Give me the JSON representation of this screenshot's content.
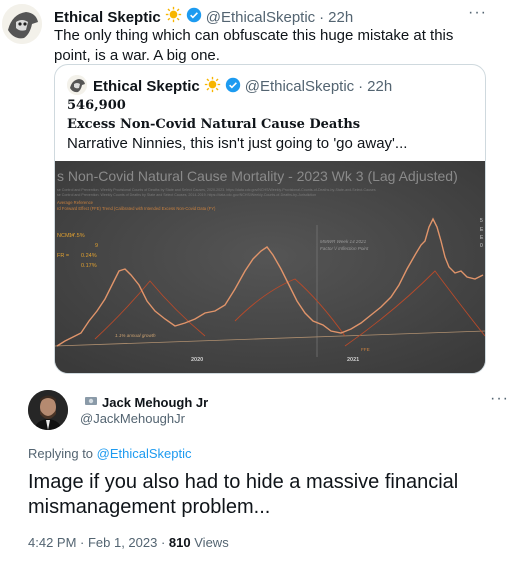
{
  "top_tweet": {
    "display_name": "Ethical Skeptic",
    "handle": "@EthicalSkeptic",
    "separator": "·",
    "time": "22h",
    "more": "···",
    "text": "The only thing which can obfuscate this huge mistake at this point, is a war. A big one."
  },
  "quote_tweet": {
    "display_name": "Ethical Skeptic",
    "handle": "@EthicalSkeptic",
    "separator": "·",
    "time": "22h",
    "line1": "546,900",
    "line2": "Excess Non-Covid Natural Cause Deaths",
    "line3": "Narrative Ninnies, this isn't just going to 'go away'...",
    "chart": {
      "title": "s Non-Covid Natural Cause Mortality - 2023 Wk 3 (Lag Adjusted)",
      "subtitle_1": "se Control and Prevention. Weekly Provisional Counts of Deaths by State and Select Causes, 2020-2023. https://data.cdc.gov/NCHS/Weekly-Provisional-Counts-of-Deaths-by-State-and-Select-Causes",
      "subtitle_2": "se Control and Prevention. Weekly Counts of Deaths by State and Select Causes, 2014-2019. https://data.cdc.gov/NCHS/Weekly-Counts-of-Deaths-by-Jurisdiction",
      "legend_1": "Average Reference",
      "legend_2": "rd Forward Effect (FFE) Trend (Calibrated with Intended Excess Non-Covid Data (FY)",
      "stats": [
        {
          "label": "NCM =",
          "value": "17.5%"
        },
        {
          "label": "",
          "value": "9"
        },
        {
          "label": "FR =",
          "value": "0.24%"
        },
        {
          "label": "",
          "value": "0.17%"
        }
      ],
      "annotation_1": "MMWR Week 14 2021",
      "annotation_2": "Factor \\/ Inflection Point",
      "growth_label": "1.1% annual growth",
      "ffe_label": "FFE",
      "x_labels": [
        "2020",
        "2021"
      ],
      "right_edge_text": [
        "5",
        "E",
        "E",
        "0"
      ]
    }
  },
  "reply": {
    "display_name": "Jack Mehough Jr",
    "handle": "@JackMehoughJr",
    "more": "···",
    "replying_prefix": "Replying to",
    "replying_to": "@EthicalSkeptic",
    "text": "Image if you also had to hide a massive financial mismanagement problem...",
    "time": "4:42 PM · Feb 1, 2023 ·",
    "views_count": "810",
    "views_label": "Views"
  },
  "colors": {
    "verified": "#1d9bf0",
    "link": "#1d9bf0",
    "secondary_text": "#536471",
    "chart_bg": "#454545",
    "chart_line": "#d88858",
    "chart_trend": "#c0392b"
  }
}
